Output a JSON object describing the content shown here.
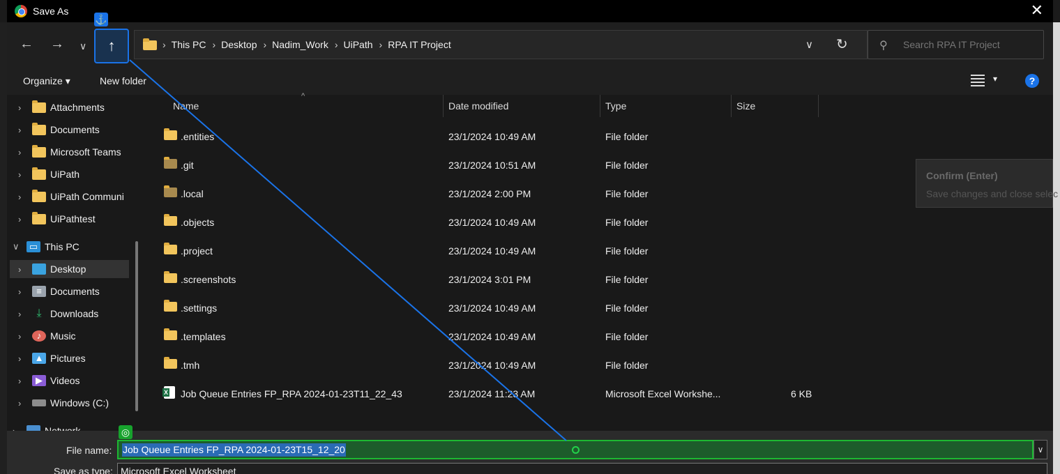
{
  "window": {
    "title": "Save As"
  },
  "nav": {
    "back": "←",
    "forward": "→",
    "recent": "∨",
    "up": "↑",
    "anchor": "⚓",
    "breadcrumbs": [
      "This PC",
      "Desktop",
      "Nadim_Work",
      "UiPath",
      "RPA IT Project"
    ],
    "separator": "›",
    "dropdown": "∨",
    "refresh": "↻"
  },
  "search": {
    "placeholder": "Search RPA IT Project"
  },
  "toolbar": {
    "organize": "Organize ▾",
    "new_folder": "New folder",
    "help": "?"
  },
  "sidebar": {
    "items": [
      {
        "label": "Attachments"
      },
      {
        "label": "Documents"
      },
      {
        "label": "Microsoft Teams"
      },
      {
        "label": "UiPath"
      },
      {
        "label": "UiPath Communi"
      },
      {
        "label": "UiPathtest"
      },
      {
        "label": "This PC"
      },
      {
        "label": "Desktop"
      },
      {
        "label": "Documents"
      },
      {
        "label": "Downloads"
      },
      {
        "label": "Music"
      },
      {
        "label": "Pictures"
      },
      {
        "label": "Videos"
      },
      {
        "label": "Windows (C:)"
      },
      {
        "label": "Network"
      }
    ]
  },
  "columns": {
    "name": "Name",
    "date": "Date modified",
    "type": "Type",
    "size": "Size"
  },
  "files": [
    {
      "name": ".entities",
      "date": "23/1/2024 10:49 AM",
      "type": "File folder",
      "size": ""
    },
    {
      "name": ".git",
      "date": "23/1/2024 10:51 AM",
      "type": "File folder",
      "size": ""
    },
    {
      "name": ".local",
      "date": "23/1/2024 2:00 PM",
      "type": "File folder",
      "size": ""
    },
    {
      "name": ".objects",
      "date": "23/1/2024 10:49 AM",
      "type": "File folder",
      "size": ""
    },
    {
      "name": ".project",
      "date": "23/1/2024 10:49 AM",
      "type": "File folder",
      "size": ""
    },
    {
      "name": ".screenshots",
      "date": "23/1/2024 3:01 PM",
      "type": "File folder",
      "size": ""
    },
    {
      "name": ".settings",
      "date": "23/1/2024 10:49 AM",
      "type": "File folder",
      "size": ""
    },
    {
      "name": ".templates",
      "date": "23/1/2024 10:49 AM",
      "type": "File folder",
      "size": ""
    },
    {
      "name": ".tmh",
      "date": "23/1/2024 10:49 AM",
      "type": "File folder",
      "size": ""
    },
    {
      "name": "Job Queue Entries FP_RPA 2024-01-23T11_22_43",
      "date": "23/1/2024 11:23 AM",
      "type": "Microsoft Excel Workshe...",
      "size": "6 KB"
    }
  ],
  "tooltip": {
    "title": "Confirm (Enter)",
    "description": "Save changes and close selec"
  },
  "bottom": {
    "file_name_label": "File name:",
    "file_name_value": "Job Queue Entries FP_RPA 2024-01-23T15_12_20",
    "save_as_type_label": "Save as type:",
    "save_as_type_value": "Microsoft Excel Worksheet"
  },
  "colors": {
    "accent": "#1a73e8",
    "target": "#1db832",
    "folder": "#f2c55c"
  }
}
